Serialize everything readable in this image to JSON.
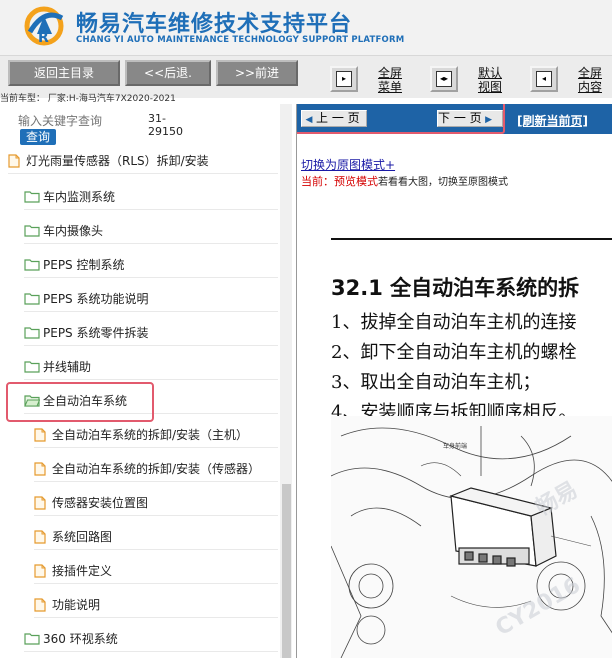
{
  "header": {
    "title": "畅易汽车维修技术支持平台",
    "subtitle": "CHANG YI AUTO MAINTENANCE TECHNOLOGY SUPPORT PLATFORM"
  },
  "toolbar": {
    "home_label": "返回主目录",
    "back_label": "<<后退.",
    "forward_label": ">>前进",
    "fullscreen_menu_label": "全屏 菜单",
    "default_view_label": "默认 视图",
    "fullscreen_content_label": "全屏 内容"
  },
  "car_model": "当前车型： 厂家:H-海马汽车7X2020-2021",
  "sidebar": {
    "search_placeholder": "输入关键字查询",
    "search_button": "查询",
    "doc_code_line1": "31-",
    "doc_code_line2": "29150",
    "items": [
      {
        "label": "灯光雨量传感器（RLS）拆卸/安装",
        "type": "document",
        "level": 0
      },
      {
        "label": "车内监测系统",
        "type": "folder",
        "level": 1
      },
      {
        "label": "车内摄像头",
        "type": "folder",
        "level": 1
      },
      {
        "label": "PEPS 控制系统",
        "type": "folder",
        "level": 1
      },
      {
        "label": "PEPS 系统功能说明",
        "type": "folder",
        "level": 1
      },
      {
        "label": "PEPS 系统零件拆装",
        "type": "folder",
        "level": 1
      },
      {
        "label": "并线辅助",
        "type": "folder",
        "level": 1
      },
      {
        "label": "全自动泊车系统",
        "type": "folder-open",
        "level": 1,
        "selected": true
      },
      {
        "label": "全自动泊车系统的拆卸/安装（主机）",
        "type": "document",
        "level": 2
      },
      {
        "label": "全自动泊车系统的拆卸/安装（传感器）",
        "type": "document",
        "level": 2
      },
      {
        "label": "传感器安装位置图",
        "type": "document",
        "level": 2
      },
      {
        "label": "系统回路图",
        "type": "document",
        "level": 2
      },
      {
        "label": "接插件定义",
        "type": "document",
        "level": 2
      },
      {
        "label": "功能说明",
        "type": "document",
        "level": 2
      },
      {
        "label": "360 环视系统",
        "type": "folder",
        "level": 1
      }
    ]
  },
  "content": {
    "prev_label": "上 一 页",
    "next_label": "下 一 页",
    "refresh_label": "[刷新当前页]",
    "switch_label": "切换为原图模式+",
    "mode_current": "当前：",
    "mode_name": "预览模式",
    "mode_hint": "若看看大图，切换至原图模式",
    "doc_heading": "32.1 全自动泊车系统的拆",
    "steps": [
      "1、拔掉全自动泊车主机的连接",
      "2、卸下全自动泊车主机的螺栓",
      "3、取出全自动泊车主机；",
      "4、安装顺序与拆卸顺序相反。"
    ]
  },
  "colors": {
    "brand_blue": "#1f6fb8",
    "pager_blue": "#1e63a6",
    "highlight": "#e25a6d",
    "folder_green": "#5aa15a",
    "doc_orange": "#e59a2f"
  }
}
